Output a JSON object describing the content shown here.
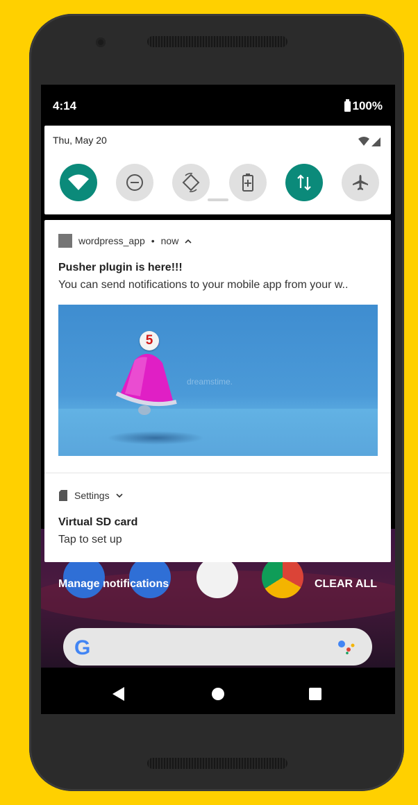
{
  "status_bar": {
    "time": "4:14",
    "battery": "100%"
  },
  "quick_settings": {
    "date": "Thu, May 20",
    "tiles": [
      {
        "icon": "wifi-icon",
        "active": true
      },
      {
        "icon": "do-not-disturb-icon",
        "active": false
      },
      {
        "icon": "auto-rotate-icon",
        "active": false
      },
      {
        "icon": "battery-saver-icon",
        "active": false
      },
      {
        "icon": "mobile-data-icon",
        "active": true
      },
      {
        "icon": "airplane-mode-icon",
        "active": false
      }
    ]
  },
  "notifications": [
    {
      "app": "wordpress_app",
      "time": "now",
      "title": "Pusher plugin is here!!!",
      "body": "You can send notifications to your mobile app from your w..",
      "image_badge": "5",
      "image_watermark": "dreamstime."
    },
    {
      "app": "Settings",
      "title": "Virtual SD card",
      "body": "Tap to set up"
    }
  ],
  "actions": {
    "manage": "Manage notifications",
    "clear_all": "CLEAR ALL"
  },
  "search": {
    "logo": "G"
  },
  "colors": {
    "accent": "#0b8a7a",
    "background": "#FFD000",
    "bell": "#e01fc5",
    "badge": "#d01818"
  }
}
